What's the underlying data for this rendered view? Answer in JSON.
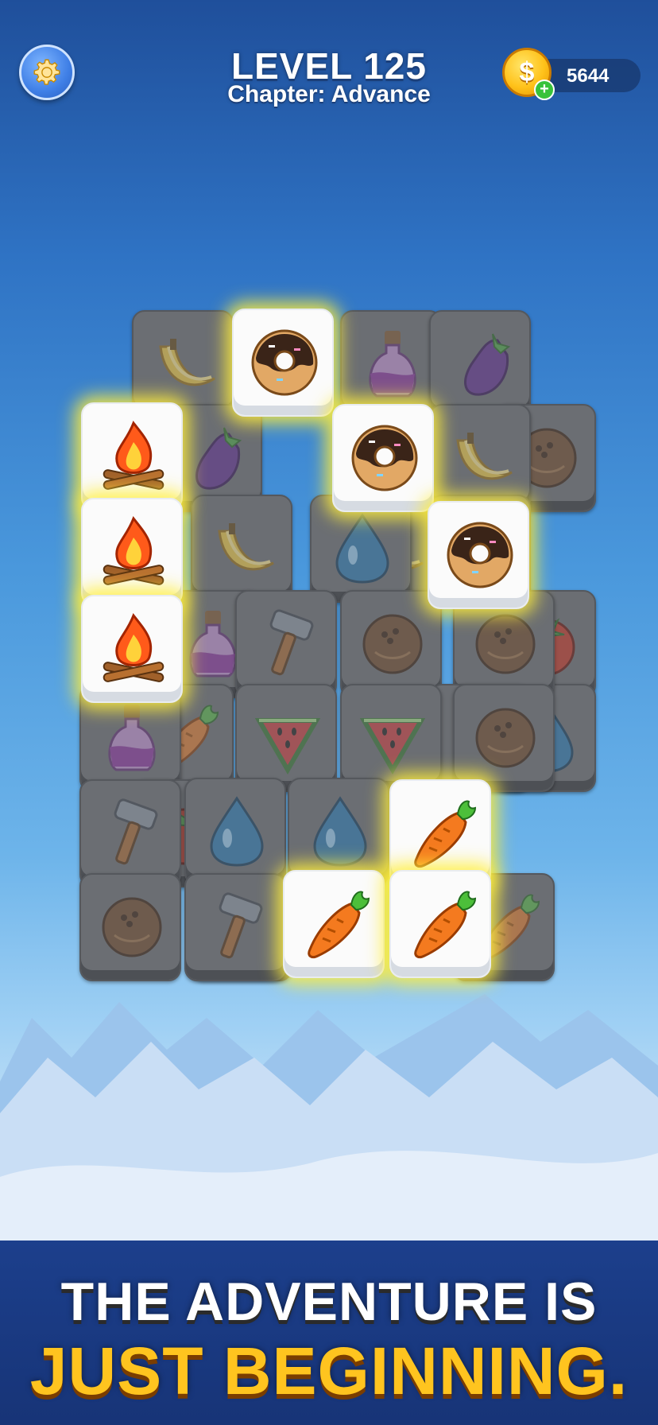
{
  "header": {
    "level_label": "LEVEL 125",
    "chapter_label": "Chapter: Advance",
    "coins": "5644",
    "coin_symbol": "$",
    "coin_plus": "+"
  },
  "banner": {
    "line1": "THE ADVENTURE IS",
    "line2": "JUST BEGINNING."
  },
  "colors": {
    "highlight": "#ffee3c",
    "tile_active": "#fbfbfb",
    "tile_dim": "#6b6e73",
    "banner_text_primary": "#ffffff",
    "banner_text_accent": "#ffc41f"
  },
  "tiles": [
    {
      "icon": "banana-icon",
      "state": "dim"
    },
    {
      "icon": "potion-icon",
      "state": "dim"
    },
    {
      "icon": "eggplant-icon",
      "state": "dim"
    },
    {
      "icon": "coconut-icon",
      "state": "dim"
    },
    {
      "icon": "eggplant-icon",
      "state": "dim"
    },
    {
      "icon": "banana-icon",
      "state": "dim"
    },
    {
      "icon": "banana-icon",
      "state": "dim"
    },
    {
      "icon": "banana-icon",
      "state": "dim"
    },
    {
      "icon": "water-drop-icon",
      "state": "dim"
    },
    {
      "icon": "banana-icon",
      "state": "dim"
    },
    {
      "icon": "tomato-icon",
      "state": "dim"
    },
    {
      "icon": "potion-icon",
      "state": "dim"
    },
    {
      "icon": "water-drop-icon",
      "state": "dim"
    },
    {
      "icon": "coconut-icon",
      "state": "dim"
    },
    {
      "icon": "coconut-icon",
      "state": "dim"
    },
    {
      "icon": "hammer-icon",
      "state": "dim"
    },
    {
      "icon": "carrot-icon",
      "state": "dim"
    },
    {
      "icon": "potion-icon",
      "state": "dim"
    },
    {
      "icon": "carrot-icon",
      "state": "dim"
    },
    {
      "icon": "tomato-icon",
      "state": "dim"
    },
    {
      "icon": "carrot-icon",
      "state": "dim"
    },
    {
      "icon": "hammer-icon",
      "state": "dim"
    },
    {
      "icon": "coconut-icon",
      "state": "dim"
    },
    {
      "icon": "carrot-icon",
      "state": "dim"
    },
    {
      "icon": "watermelon-icon",
      "state": "dim"
    },
    {
      "icon": "watermelon-icon",
      "state": "dim"
    },
    {
      "icon": "coconut-icon",
      "state": "dim"
    },
    {
      "icon": "water-drop-icon",
      "state": "dim"
    },
    {
      "icon": "water-drop-icon",
      "state": "dim"
    },
    {
      "icon": "hammer-icon",
      "state": "dim"
    },
    {
      "icon": "donut-icon",
      "state": "active"
    },
    {
      "icon": "campfire-icon",
      "state": "active"
    },
    {
      "icon": "donut-icon",
      "state": "active"
    },
    {
      "icon": "campfire-icon",
      "state": "active"
    },
    {
      "icon": "donut-icon",
      "state": "active"
    },
    {
      "icon": "campfire-icon",
      "state": "active"
    },
    {
      "icon": "carrot-icon",
      "state": "active"
    },
    {
      "icon": "carrot-icon",
      "state": "active"
    },
    {
      "icon": "carrot-icon",
      "state": "active"
    }
  ]
}
